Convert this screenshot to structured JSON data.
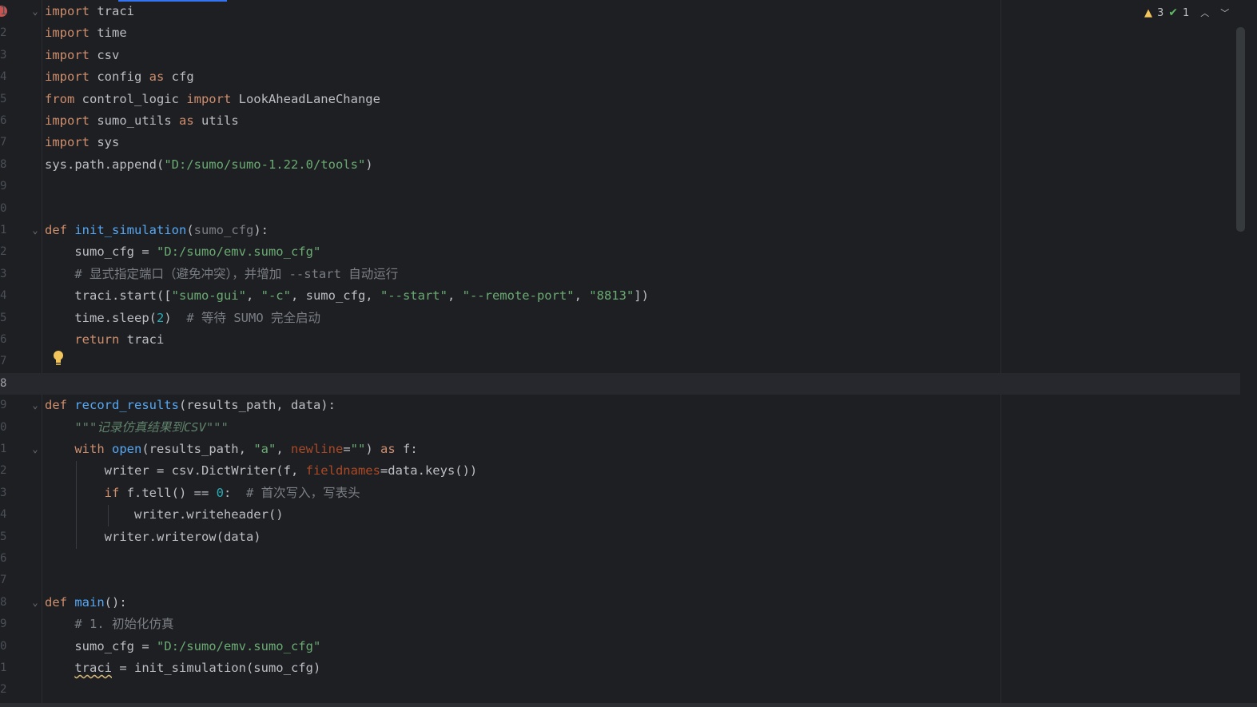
{
  "status": {
    "warning_count": "3",
    "ok_count": "1"
  },
  "lines": [
    {
      "n": "1",
      "parts": [
        [
          "kw",
          "import"
        ],
        [
          "t",
          " traci"
        ]
      ]
    },
    {
      "n": "2",
      "parts": [
        [
          "kw",
          "import"
        ],
        [
          "t",
          " time"
        ]
      ]
    },
    {
      "n": "3",
      "parts": [
        [
          "kw",
          "import"
        ],
        [
          "t",
          " csv"
        ]
      ]
    },
    {
      "n": "4",
      "parts": [
        [
          "kw",
          "import"
        ],
        [
          "t",
          " config "
        ],
        [
          "kw",
          "as"
        ],
        [
          "t",
          " cfg"
        ]
      ]
    },
    {
      "n": "5",
      "parts": [
        [
          "kw",
          "from"
        ],
        [
          "t",
          " control_logic "
        ],
        [
          "kw",
          "import"
        ],
        [
          "t",
          " LookAheadLaneChange"
        ]
      ]
    },
    {
      "n": "6",
      "parts": [
        [
          "kw",
          "import"
        ],
        [
          "t",
          " sumo_utils "
        ],
        [
          "kw",
          "as"
        ],
        [
          "t",
          " utils"
        ]
      ]
    },
    {
      "n": "7",
      "parts": [
        [
          "kw",
          "import"
        ],
        [
          "t",
          " sys"
        ]
      ]
    },
    {
      "n": "8",
      "parts": [
        [
          "t",
          "sys.path.append("
        ],
        [
          "str",
          "\"D:/sumo/sumo-1.22.0/tools\""
        ],
        [
          "t",
          ")"
        ]
      ]
    },
    {
      "n": "9",
      "parts": []
    },
    {
      "n": "0",
      "parts": []
    },
    {
      "n": "1",
      "parts": [
        [
          "kw",
          "def "
        ],
        [
          "fn",
          "init_simulation"
        ],
        [
          "t",
          "("
        ],
        [
          "param-dim",
          "sumo_cfg"
        ],
        [
          "t",
          "):"
        ]
      ]
    },
    {
      "n": "2",
      "parts": [
        [
          "t",
          "    sumo_cfg = "
        ],
        [
          "str",
          "\"D:/sumo/emv.sumo_cfg\""
        ]
      ]
    },
    {
      "n": "3",
      "parts": [
        [
          "cmt",
          "    # 显式指定端口（避免冲突），并增加 --start 自动运行"
        ]
      ]
    },
    {
      "n": "4",
      "parts": [
        [
          "t",
          "    traci.start(["
        ],
        [
          "str",
          "\"sumo-gui\""
        ],
        [
          "t",
          ", "
        ],
        [
          "str",
          "\"-c\""
        ],
        [
          "t",
          ", sumo_cfg, "
        ],
        [
          "str",
          "\"--start\""
        ],
        [
          "t",
          ", "
        ],
        [
          "str",
          "\"--remote-port\""
        ],
        [
          "t",
          ", "
        ],
        [
          "str",
          "\"8813\""
        ],
        [
          "t",
          "])"
        ]
      ]
    },
    {
      "n": "5",
      "parts": [
        [
          "t",
          "    time.sleep("
        ],
        [
          "num",
          "2"
        ],
        [
          "t",
          ")  "
        ],
        [
          "cmt",
          "# 等待 SUMO 完全启动"
        ]
      ]
    },
    {
      "n": "6",
      "parts": [
        [
          "kw",
          "    return"
        ],
        [
          "t",
          " traci"
        ]
      ]
    },
    {
      "n": "7",
      "parts": []
    },
    {
      "n": "8",
      "parts": []
    },
    {
      "n": "9",
      "parts": [
        [
          "kw",
          "def "
        ],
        [
          "fn",
          "record_results"
        ],
        [
          "t",
          "(results_path, data):"
        ]
      ]
    },
    {
      "n": "0",
      "parts": [
        [
          "doc",
          "    \"\"\"记录仿真结果到CSV\"\"\""
        ]
      ]
    },
    {
      "n": "1",
      "parts": [
        [
          "kw",
          "    with"
        ],
        [
          "t",
          " "
        ],
        [
          "bi",
          "open"
        ],
        [
          "t",
          "(results_path, "
        ],
        [
          "str",
          "\"a\""
        ],
        [
          "t",
          ", "
        ],
        [
          "kwarg",
          "newline"
        ],
        [
          "t",
          "="
        ],
        [
          "str",
          "\"\""
        ],
        [
          "t",
          ") "
        ],
        [
          "kw",
          "as"
        ],
        [
          "t",
          " f:"
        ]
      ]
    },
    {
      "n": "2",
      "parts": [
        [
          "t",
          "        writer = csv.DictWriter(f, "
        ],
        [
          "kwarg",
          "fieldnames"
        ],
        [
          "t",
          "=data.keys())"
        ]
      ]
    },
    {
      "n": "3",
      "parts": [
        [
          "kw",
          "        if"
        ],
        [
          "t",
          " f.tell() == "
        ],
        [
          "num",
          "0"
        ],
        [
          "t",
          ":  "
        ],
        [
          "cmt",
          "# 首次写入，写表头"
        ]
      ]
    },
    {
      "n": "4",
      "parts": [
        [
          "t",
          "            writer.writeheader()"
        ]
      ]
    },
    {
      "n": "5",
      "parts": [
        [
          "t",
          "        writer.writerow(data)"
        ]
      ]
    },
    {
      "n": "6",
      "parts": []
    },
    {
      "n": "7",
      "parts": []
    },
    {
      "n": "8",
      "parts": [
        [
          "kw",
          "def "
        ],
        [
          "fn",
          "main"
        ],
        [
          "t",
          "():"
        ]
      ]
    },
    {
      "n": "9",
      "parts": [
        [
          "cmt",
          "    # 1. 初始化仿真"
        ]
      ]
    },
    {
      "n": "0",
      "parts": [
        [
          "t",
          "    sumo_cfg = "
        ],
        [
          "str",
          "\"D:/sumo/emv.sumo_cfg\""
        ]
      ]
    },
    {
      "n": "1",
      "parts": [
        [
          "t",
          "    "
        ],
        [
          "squiggle",
          "traci"
        ],
        [
          "t",
          " = init_simulation(sumo_cfg)"
        ]
      ]
    },
    {
      "n": "2",
      "parts": []
    }
  ]
}
